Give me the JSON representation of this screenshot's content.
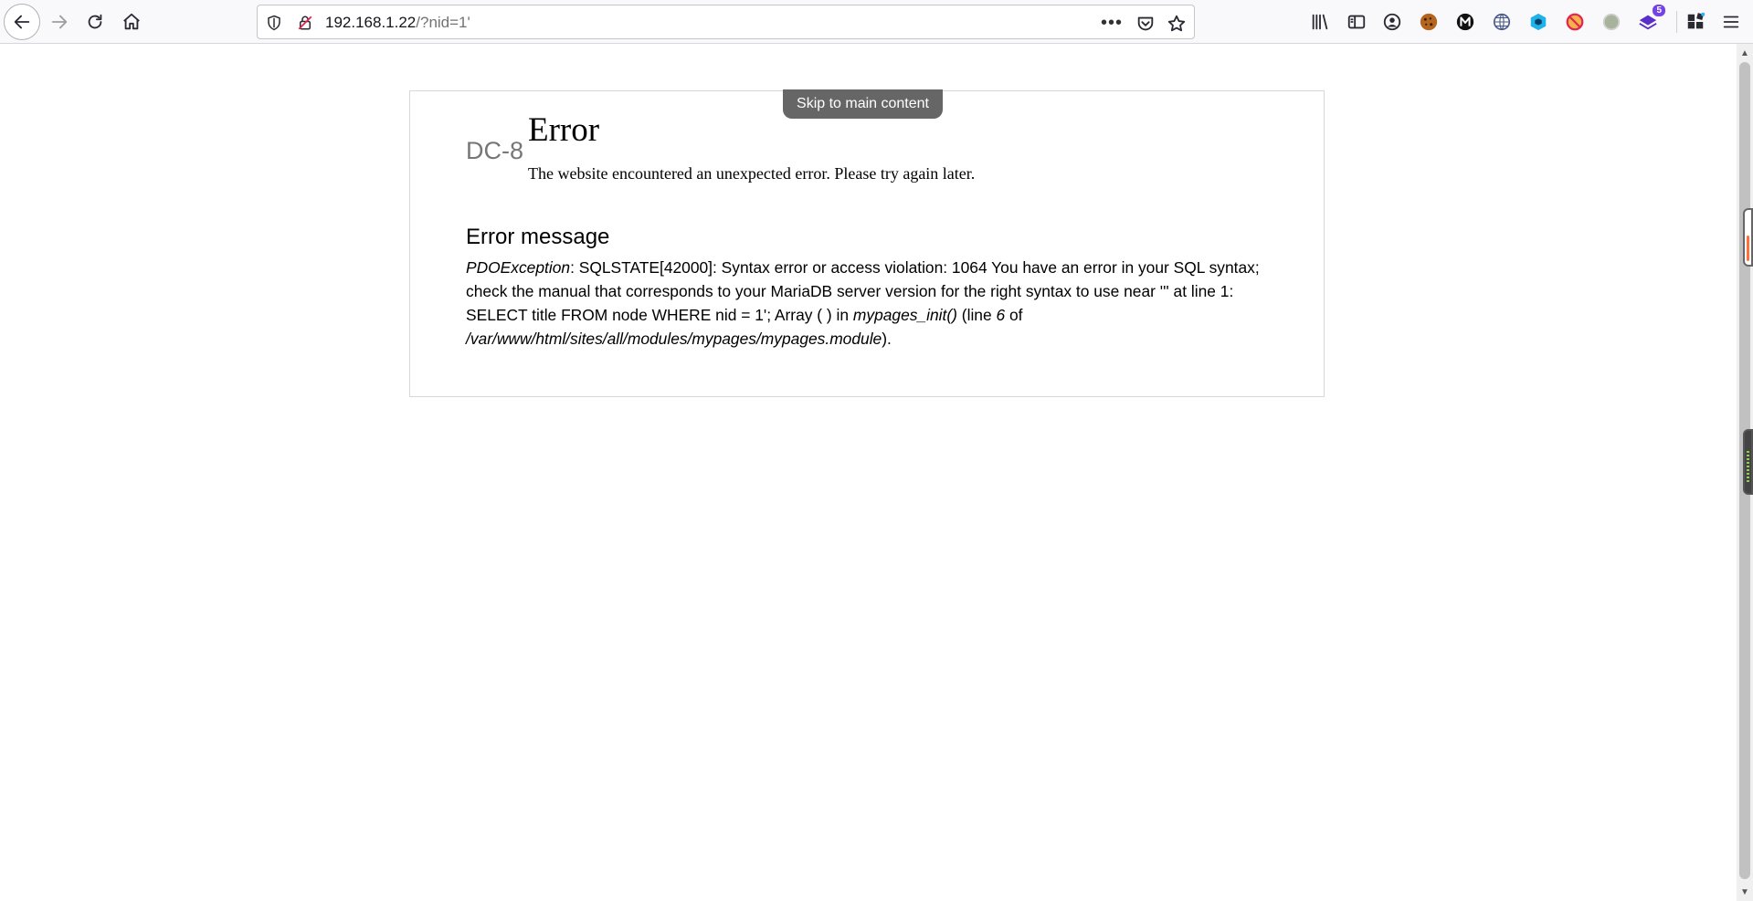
{
  "browser": {
    "url_host": "192.168.1.22",
    "url_path": "/?nid=1'",
    "extension_badge": "5",
    "icons": {
      "back": "arrow-left-icon",
      "forward": "arrow-right-icon",
      "reload": "reload-icon",
      "home": "home-icon",
      "shield": "tracking-shield-icon",
      "insecure": "insecure-lock-icon",
      "more": "ellipsis-icon",
      "pocket": "pocket-icon",
      "bookmark": "star-icon",
      "library": "library-icon",
      "sidebar": "sidebar-icon",
      "account": "account-icon",
      "menu": "hamburger-menu-icon"
    },
    "colors": {
      "toolbar_bg": "#f9f9fb",
      "insecure_red": "#e22850",
      "badge_purple": "#7542e5",
      "scroll_accent": "#ff7139"
    }
  },
  "page": {
    "skip_link": "Skip to main content",
    "site_name": "DC-8",
    "title": "Error",
    "subtitle": "The website encountered an unexpected error. Please try again later.",
    "message_heading": "Error message",
    "message": {
      "exception": "PDOException",
      "text1": ": SQLSTATE[42000]: Syntax error or access violation: 1064 You have an error in your SQL syntax; check the manual that corresponds to your MariaDB server version for the right syntax to use near ''' at line 1: SELECT title FROM node WHERE nid = 1'; Array ( ) in ",
      "function": "mypages_init()",
      "text2": " (line ",
      "line": "6",
      "text3": " of ",
      "file": "/var/www/html/sites/all/modules/mypages/mypages.module",
      "text4": ")."
    }
  }
}
